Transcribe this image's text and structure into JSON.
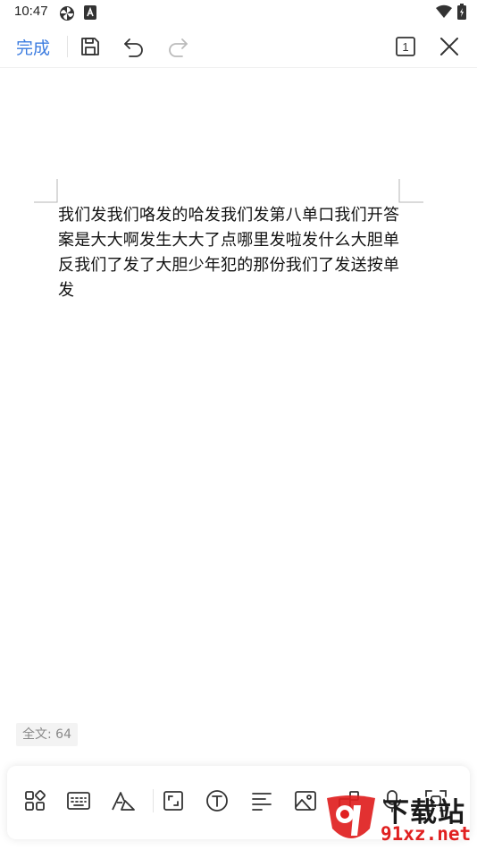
{
  "status_bar": {
    "time": "10:47",
    "icons": [
      "pinwheel-icon",
      "a-badge-icon",
      "wifi-icon",
      "battery-icon"
    ]
  },
  "toolbar": {
    "done_label": "完成",
    "icons": [
      "save-icon",
      "undo-icon",
      "redo-icon",
      "page-count-icon",
      "close-icon"
    ],
    "page_count": "1"
  },
  "document": {
    "text": "我们发我们咯发的哈发我们发第八单口我们开答案是大大啊发生大大了点哪里发啦发什么大胆单反我们了发了大胆少年犯的那份我们了发送按单发"
  },
  "word_count": {
    "label": "全文: 64"
  },
  "bottom_toolbar": {
    "icons": [
      "apps-grid-icon",
      "keyboard-icon",
      "text-style-icon",
      "expand-icon",
      "text-box-icon",
      "align-left-icon",
      "image-icon",
      "shape-icon",
      "microphone-icon",
      "scan-icon"
    ]
  },
  "watermark": {
    "brand": "下载站",
    "url": "91xz.net"
  },
  "colors": {
    "accent": "#3c7ce0",
    "icon": "#333333",
    "icon_disabled": "#bbbbbb",
    "watermark_red": "#e02020"
  }
}
